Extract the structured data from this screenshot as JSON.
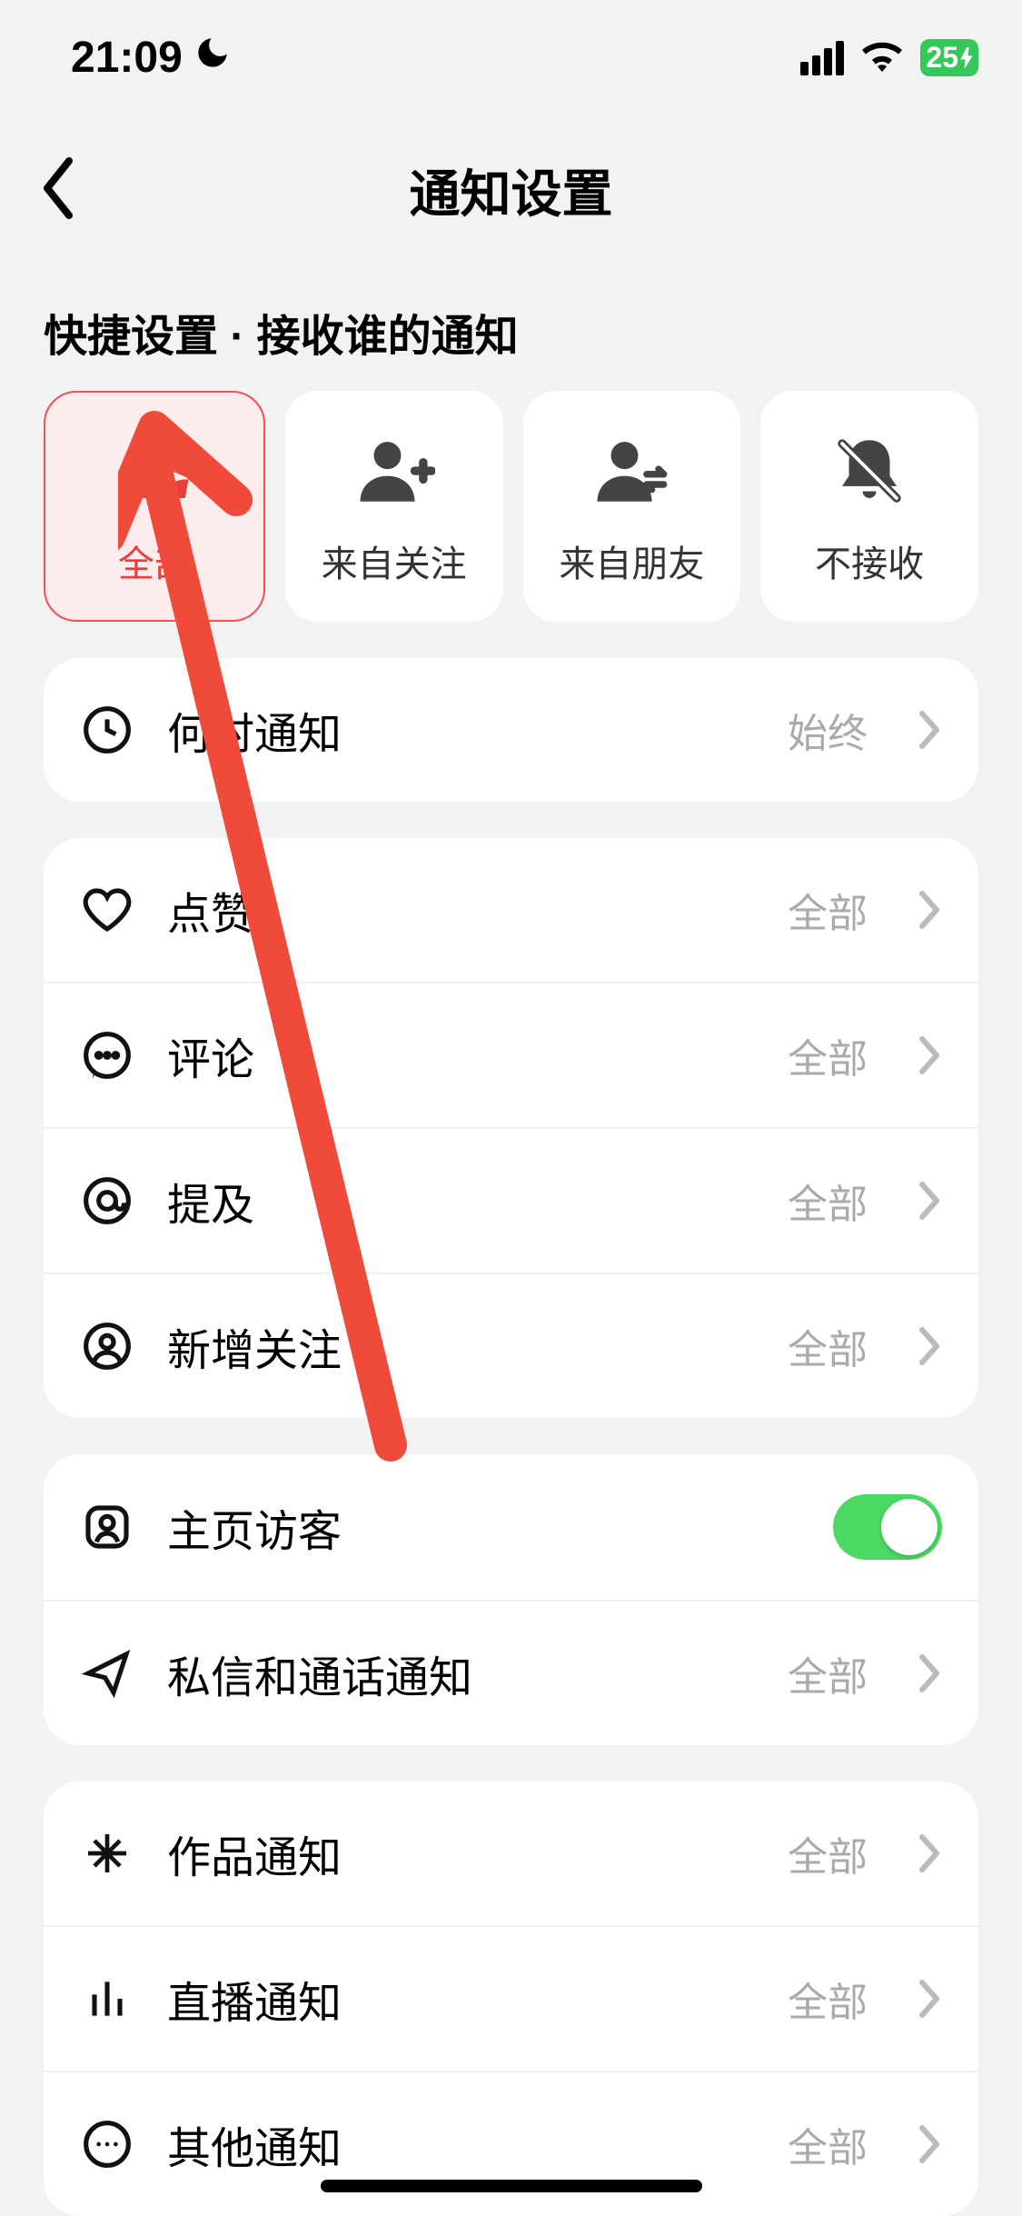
{
  "status": {
    "time": "21:09",
    "battery": "25"
  },
  "header": {
    "title": "通知设置"
  },
  "quick": {
    "title": "快捷设置 · 接收谁的通知",
    "items": [
      {
        "label": "全部"
      },
      {
        "label": "来自关注"
      },
      {
        "label": "来自朋友"
      },
      {
        "label": "不接收"
      }
    ]
  },
  "groups": [
    {
      "rows": [
        {
          "label": "何时通知",
          "value": "始终"
        }
      ]
    },
    {
      "rows": [
        {
          "label": "点赞",
          "value": "全部"
        },
        {
          "label": "评论",
          "value": "全部"
        },
        {
          "label": "提及",
          "value": "全部"
        },
        {
          "label": "新增关注",
          "value": "全部"
        }
      ]
    },
    {
      "rows": [
        {
          "label": "主页访客",
          "toggle": true
        },
        {
          "label": "私信和通话通知",
          "value": "全部"
        }
      ]
    },
    {
      "rows": [
        {
          "label": "作品通知",
          "value": "全部"
        },
        {
          "label": "直播通知",
          "value": "全部"
        },
        {
          "label": "其他通知",
          "value": "全部"
        }
      ]
    }
  ]
}
